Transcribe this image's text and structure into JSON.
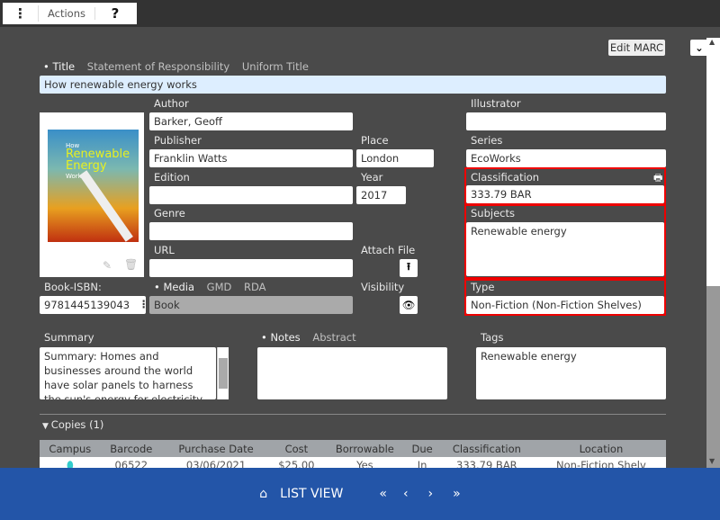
{
  "toolbar": {
    "actions_label": "Actions",
    "help_label": "?"
  },
  "edit_marc_label": "Edit MARC",
  "title_tabs": [
    "Title",
    "Statement of Responsibility",
    "Uniform Title"
  ],
  "title_value": "How renewable energy works",
  "cover": {
    "line1": "How",
    "line2": "Renewable",
    "line3": "Energy",
    "line4": "Works"
  },
  "fields": {
    "author": {
      "label": "Author",
      "value": "Barker, Geoff"
    },
    "publisher": {
      "label": "Publisher",
      "value": "Franklin Watts"
    },
    "place": {
      "label": "Place",
      "value": "London"
    },
    "edition": {
      "label": "Edition",
      "value": ""
    },
    "year": {
      "label": "Year",
      "value": "2017"
    },
    "genre": {
      "label": "Genre",
      "value": ""
    },
    "url": {
      "label": "URL",
      "value": ""
    },
    "attach_file": {
      "label": "Attach File"
    },
    "illustrator": {
      "label": "Illustrator",
      "value": ""
    },
    "series": {
      "label": "Series",
      "value": "EcoWorks"
    },
    "classification": {
      "label": "Classification",
      "value": "333.79 BAR"
    },
    "subjects": {
      "label": "Subjects",
      "value": "Renewable energy"
    },
    "type": {
      "label": "Type",
      "value": "Non-Fiction (Non-Fiction Shelves)"
    },
    "isbn": {
      "label": "Book-ISBN:",
      "value": "9781445139043"
    },
    "visibility": {
      "label": "Visibility"
    }
  },
  "media_tabs": [
    "Media",
    "GMD",
    "RDA"
  ],
  "media_value": "Book",
  "summary": {
    "label": "Summary",
    "value": "Summary: Homes and businesses around the world have solar panels to harness the sun's energy for electricity. But even more"
  },
  "notes_tabs": [
    "Notes",
    "Abstract"
  ],
  "notes_value": "",
  "tags": {
    "label": "Tags",
    "value": "Renewable energy"
  },
  "copies": {
    "label": "Copies (1)",
    "headers": [
      "Campus",
      "Barcode",
      "Purchase Date",
      "Cost",
      "Borrowable",
      "Due",
      "Classification",
      "Location"
    ],
    "rows": [
      [
        "",
        "06522",
        "03/06/2021",
        "$25.00",
        "Yes",
        "In",
        "333.79 BAR",
        "Non-Fiction Shelv"
      ]
    ]
  },
  "footer": {
    "list_view": "LIST VIEW"
  },
  "colors": {
    "background": "#4a4a4a",
    "footer": "#2355a8",
    "highlight": "#e00000",
    "title_input": "#ddeeff"
  }
}
